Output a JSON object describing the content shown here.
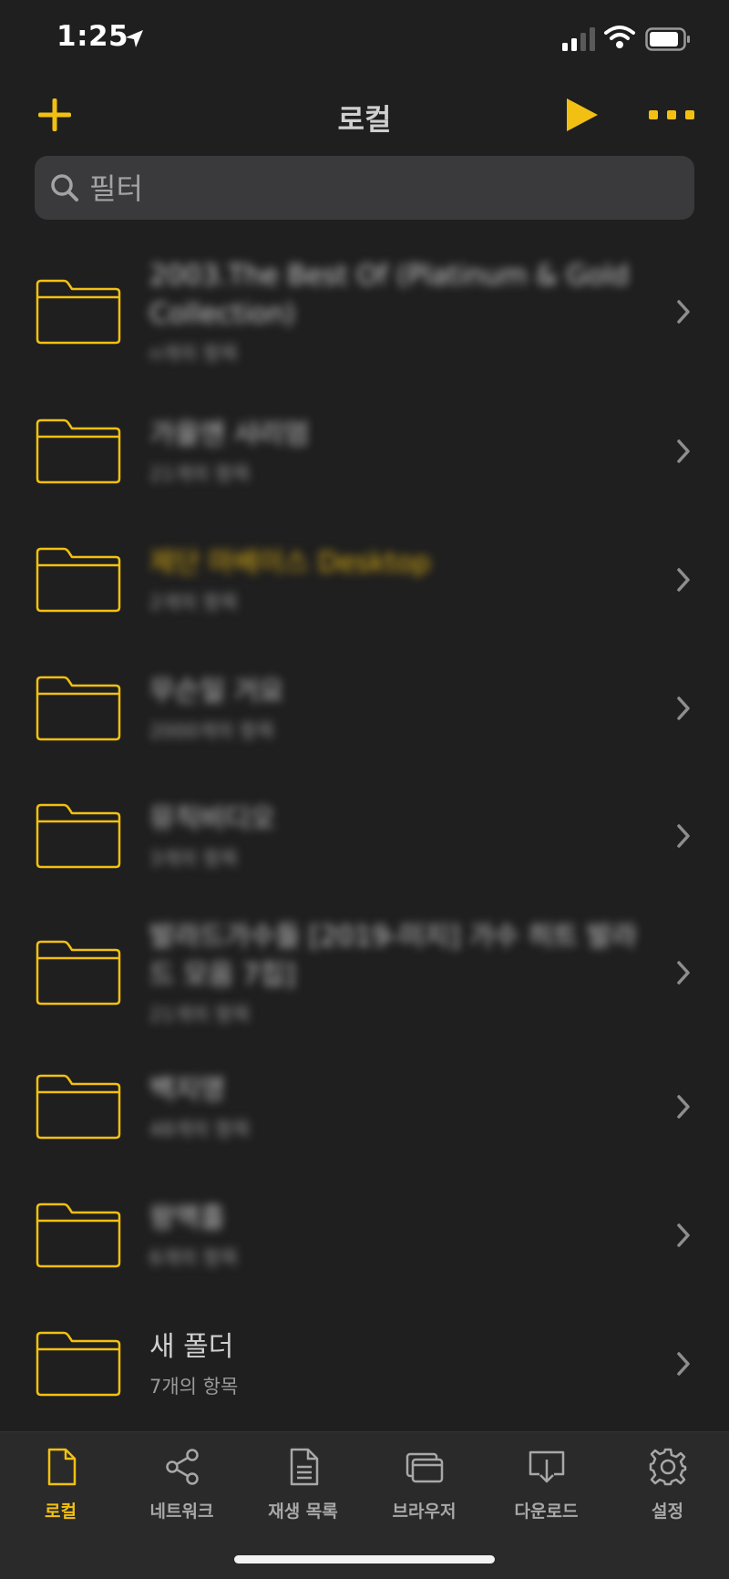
{
  "status_bar": {
    "time": "1:25"
  },
  "nav": {
    "title": "로컬"
  },
  "search": {
    "placeholder": "필터"
  },
  "folders": [
    {
      "title": "2003.The Best Of (Platinum & Gold Collection)",
      "subtitle": "n개의 항목"
    },
    {
      "title": "가을엔 샤리엄",
      "subtitle": "21개의 항목"
    },
    {
      "title": "제단 마베이스 Desktop",
      "subtitle": "2개의 항목"
    },
    {
      "title": "무슨일 거요",
      "subtitle": "2000개의 항목"
    },
    {
      "title": "뮤직비디오",
      "subtitle": "3개의 항목"
    },
    {
      "title": "발라드가수들 [2019-미지] 가수 히트 발라드 모음 7집]",
      "subtitle": "21개의 항목"
    },
    {
      "title": "백지영",
      "subtitle": "48개의 항목"
    },
    {
      "title": "왕맥흘",
      "subtitle": "6개의 항목"
    },
    {
      "title": "새 폴더",
      "subtitle": "7개의 항목"
    }
  ],
  "tabs": [
    {
      "label": "로컬",
      "icon": "document-icon"
    },
    {
      "label": "네트워크",
      "icon": "share-icon"
    },
    {
      "label": "재생 목록",
      "icon": "playlist-icon"
    },
    {
      "label": "브라우저",
      "icon": "browser-icon"
    },
    {
      "label": "다운로드",
      "icon": "download-icon"
    },
    {
      "label": "설정",
      "icon": "gear-icon"
    }
  ],
  "colors": {
    "accent": "#F2C012",
    "background": "#1F1F1F",
    "search_bg": "#3A3A3C"
  }
}
